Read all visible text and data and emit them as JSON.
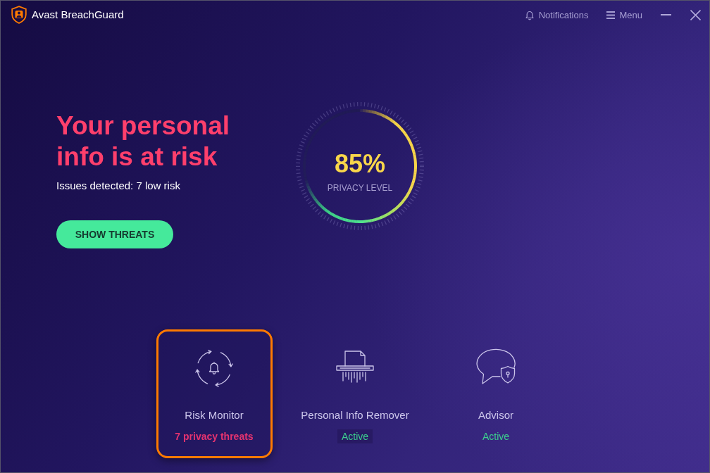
{
  "window": {
    "title": "Avast BreachGuard"
  },
  "toolbar": [
    {
      "kind": "notifications",
      "label": "Notifications"
    },
    {
      "kind": "menu",
      "label": "Menu"
    }
  ],
  "hero": {
    "headline": "Your personal info is at risk",
    "summary": "Issues detected: 7 low risk",
    "button": "SHOW THREATS"
  },
  "gauge": {
    "value": "85%",
    "label": "PRIVACY LEVEL"
  },
  "features": [
    {
      "kind": "monitor",
      "name": "Risk Monitor",
      "selected": true,
      "status": {
        "text": "7 privacy threats",
        "kind": "alert",
        "highlighted": false
      }
    },
    {
      "kind": "remover",
      "name": "Personal Info Remover",
      "selected": false,
      "status": {
        "text": "Active",
        "kind": "ok",
        "highlighted": true
      }
    },
    {
      "kind": "advisor",
      "name": "Advisor",
      "selected": false,
      "status": {
        "text": "Active",
        "kind": "ok",
        "highlighted": false
      }
    }
  ]
}
